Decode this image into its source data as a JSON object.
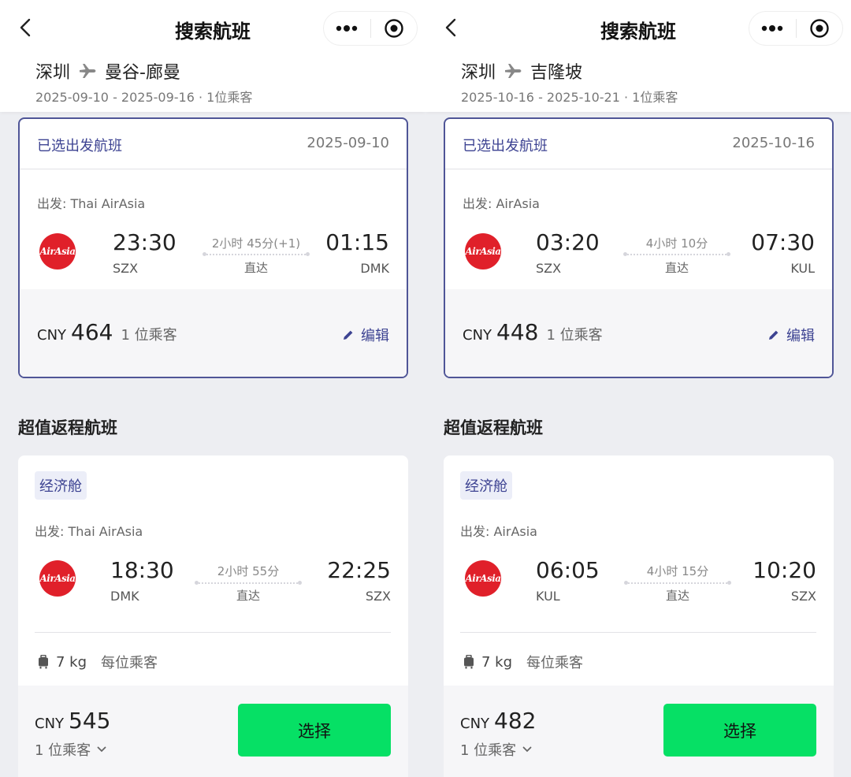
{
  "panels": [
    {
      "nav_title": "搜索航班",
      "route_from": "深圳",
      "route_to": "曼谷-廊曼",
      "route_sub": "2025-09-10 - 2025-09-16 · 1位乘客",
      "selected": {
        "header": "已选出发航班",
        "date": "2025-09-10",
        "operator": "出发: Thai AirAsia",
        "logo_text": "AirAsia",
        "dep_time": "23:30",
        "dep_code": "SZX",
        "duration": "2小时 45分(+1)",
        "stops": "直达",
        "arr_time": "01:15",
        "arr_code": "DMK",
        "currency": "CNY",
        "price": "464",
        "pax": "1 位乘客",
        "edit": "编辑"
      },
      "section_title": "超值返程航班",
      "return": {
        "class": "经济舱",
        "operator": "出发: Thai AirAsia",
        "logo_text": "AirAsia",
        "dep_time": "18:30",
        "dep_code": "DMK",
        "duration": "2小时 55分",
        "stops": "直达",
        "arr_time": "22:25",
        "arr_code": "SZX",
        "bag_weight": "7 kg",
        "bag_per": "每位乘客",
        "currency": "CNY",
        "price": "545",
        "pax": "1 位乘客",
        "select": "选择"
      }
    },
    {
      "nav_title": "搜索航班",
      "route_from": "深圳",
      "route_to": "吉隆坡",
      "route_sub": "2025-10-16 - 2025-10-21 · 1位乘客",
      "selected": {
        "header": "已选出发航班",
        "date": "2025-10-16",
        "operator": "出发: AirAsia",
        "logo_text": "AirAsia",
        "dep_time": "03:20",
        "dep_code": "SZX",
        "duration": "4小时 10分",
        "stops": "直达",
        "arr_time": "07:30",
        "arr_code": "KUL",
        "currency": "CNY",
        "price": "448",
        "pax": "1 位乘客",
        "edit": "编辑"
      },
      "section_title": "超值返程航班",
      "return": {
        "class": "经济舱",
        "operator": "出发: AirAsia",
        "logo_text": "AirAsia",
        "dep_time": "06:05",
        "dep_code": "KUL",
        "duration": "4小时 15分",
        "stops": "直达",
        "arr_time": "10:20",
        "arr_code": "SZX",
        "bag_weight": "7 kg",
        "bag_per": "每位乘客",
        "currency": "CNY",
        "price": "482",
        "pax": "1 位乘客",
        "select": "选择"
      }
    }
  ],
  "icons": [
    "back-arrow-icon",
    "more-dots-icon",
    "target-icon",
    "plane-icon",
    "airasia-logo-icon",
    "pencil-icon",
    "luggage-icon",
    "chevron-down-icon"
  ],
  "colors": {
    "accent": "#3d4392",
    "select_green": "#06e065",
    "logo_red": "#e0202a"
  }
}
